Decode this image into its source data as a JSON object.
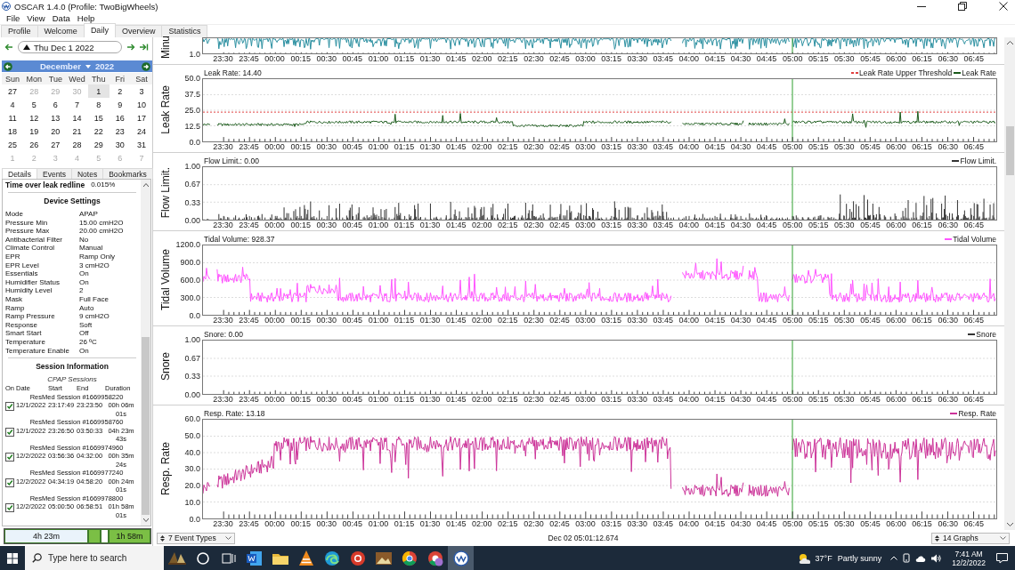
{
  "window": {
    "title": "OSCAR 1.4.0 (Profile: TwoBigWheels)"
  },
  "menu": [
    "File",
    "View",
    "Data",
    "Help"
  ],
  "tabs": [
    {
      "label": "Profile",
      "selected": false
    },
    {
      "label": "Welcome",
      "selected": false
    },
    {
      "label": "Daily",
      "selected": true
    },
    {
      "label": "Overview",
      "selected": false
    },
    {
      "label": "Statistics",
      "selected": false
    }
  ],
  "date_nav": {
    "date": "Thu Dec 1 2022"
  },
  "calendar": {
    "month": "December",
    "year": "2022",
    "weekdays": [
      "Sun",
      "Mon",
      "Tue",
      "Wed",
      "Thu",
      "Fri",
      "Sat"
    ],
    "weeks": [
      [
        {
          "day": "27",
          "dimmed": false,
          "selected": false
        },
        {
          "day": "28",
          "dimmed": true,
          "selected": false
        },
        {
          "day": "29",
          "dimmed": true,
          "selected": false
        },
        {
          "day": "30",
          "dimmed": true,
          "selected": false
        },
        {
          "day": "1",
          "dimmed": false,
          "selected": true
        },
        {
          "day": "2",
          "dimmed": false,
          "selected": false
        },
        {
          "day": "3",
          "dimmed": false,
          "selected": false
        }
      ],
      [
        {
          "day": "4",
          "dimmed": false,
          "selected": false
        },
        {
          "day": "5",
          "dimmed": false,
          "selected": false
        },
        {
          "day": "6",
          "dimmed": false,
          "selected": false
        },
        {
          "day": "7",
          "dimmed": false,
          "selected": false
        },
        {
          "day": "8",
          "dimmed": false,
          "selected": false
        },
        {
          "day": "9",
          "dimmed": false,
          "selected": false
        },
        {
          "day": "10",
          "dimmed": false,
          "selected": false
        }
      ],
      [
        {
          "day": "11",
          "dimmed": false,
          "selected": false
        },
        {
          "day": "12",
          "dimmed": false,
          "selected": false
        },
        {
          "day": "13",
          "dimmed": false,
          "selected": false
        },
        {
          "day": "14",
          "dimmed": false,
          "selected": false
        },
        {
          "day": "15",
          "dimmed": false,
          "selected": false
        },
        {
          "day": "16",
          "dimmed": false,
          "selected": false
        },
        {
          "day": "17",
          "dimmed": false,
          "selected": false
        }
      ],
      [
        {
          "day": "18",
          "dimmed": false,
          "selected": false
        },
        {
          "day": "19",
          "dimmed": false,
          "selected": false
        },
        {
          "day": "20",
          "dimmed": false,
          "selected": false
        },
        {
          "day": "21",
          "dimmed": false,
          "selected": false
        },
        {
          "day": "22",
          "dimmed": false,
          "selected": false
        },
        {
          "day": "23",
          "dimmed": false,
          "selected": false
        },
        {
          "day": "24",
          "dimmed": false,
          "selected": false
        }
      ],
      [
        {
          "day": "25",
          "dimmed": false,
          "selected": false
        },
        {
          "day": "26",
          "dimmed": false,
          "selected": false
        },
        {
          "day": "27",
          "dimmed": false,
          "selected": false
        },
        {
          "day": "28",
          "dimmed": false,
          "selected": false
        },
        {
          "day": "29",
          "dimmed": false,
          "selected": false
        },
        {
          "day": "30",
          "dimmed": false,
          "selected": false
        },
        {
          "day": "31",
          "dimmed": false,
          "selected": false
        }
      ],
      [
        {
          "day": "1",
          "dimmed": true,
          "selected": false
        },
        {
          "day": "2",
          "dimmed": true,
          "selected": false
        },
        {
          "day": "3",
          "dimmed": true,
          "selected": false
        },
        {
          "day": "4",
          "dimmed": true,
          "selected": false
        },
        {
          "day": "5",
          "dimmed": true,
          "selected": false
        },
        {
          "day": "6",
          "dimmed": true,
          "selected": false
        },
        {
          "day": "7",
          "dimmed": true,
          "selected": false
        }
      ]
    ]
  },
  "detail_tabs": [
    {
      "label": "Details",
      "selected": true
    },
    {
      "label": "Events",
      "selected": false
    },
    {
      "label": "Notes",
      "selected": false
    },
    {
      "label": "Bookmarks",
      "selected": false
    }
  ],
  "details": {
    "summary": [
      {
        "label": "Time over leak redline",
        "value": "0.015%"
      }
    ],
    "device_settings": {
      "heading": "Device Settings",
      "rows": [
        {
          "label": "Mode",
          "value": "APAP"
        },
        {
          "label": "Pressure Min",
          "value": "15.00 cmH2O"
        },
        {
          "label": "Pressure Max",
          "value": "20.00 cmH2O"
        },
        {
          "label": "Antibacterial Filter",
          "value": "No"
        },
        {
          "label": "Climate Control",
          "value": "Manual"
        },
        {
          "label": "EPR",
          "value": "Ramp Only"
        },
        {
          "label": "EPR Level",
          "value": "3 cmH2O"
        },
        {
          "label": "Essentials",
          "value": "On"
        },
        {
          "label": "Humidifier Status",
          "value": "On"
        },
        {
          "label": "Humidity Level",
          "value": "2"
        },
        {
          "label": "Mask",
          "value": "Full Face"
        },
        {
          "label": "Ramp",
          "value": "Auto"
        },
        {
          "label": "Ramp Pressure",
          "value": "9 cmH2O"
        },
        {
          "label": "Response",
          "value": "Soft"
        },
        {
          "label": "Smart Start",
          "value": "Off"
        },
        {
          "label": "Temperature",
          "value": "26 ºC"
        },
        {
          "label": "Temperature Enable",
          "value": "On"
        }
      ]
    },
    "session_info": {
      "heading": "Session Information",
      "subheading": "CPAP Sessions",
      "columns": [
        "On",
        "Date",
        "Start",
        "End",
        "Duration"
      ],
      "sessions": [
        {
          "title": "ResMed Session #1669958220",
          "checked": true,
          "date": "12/1/2022",
          "start": "23:17:49",
          "end": "23:23:50",
          "duration": "00h 06m 01s"
        },
        {
          "title": "ResMed Session #1669958760",
          "checked": true,
          "date": "12/1/2022",
          "start": "23:26:50",
          "end": "03:50:33",
          "duration": "04h 23m 43s"
        },
        {
          "title": "ResMed Session #1669974960",
          "checked": true,
          "date": "12/2/2022",
          "start": "03:56:36",
          "end": "04:32:00",
          "duration": "00h 35m 24s"
        },
        {
          "title": "ResMed Session #1669977240",
          "checked": true,
          "date": "12/2/2022",
          "start": "04:34:19",
          "end": "04:58:20",
          "duration": "00h 24m 01s"
        },
        {
          "title": "ResMed Session #1669978800",
          "checked": true,
          "date": "12/2/2022",
          "start": "05:00:50",
          "end": "06:58:51",
          "duration": "01h 58m 01s"
        }
      ]
    }
  },
  "timeline": {
    "segments": [
      {
        "text": "4h 23m",
        "kind": "pale"
      },
      {
        "kind": "green"
      },
      {
        "kind": "white"
      },
      {
        "text": "1h 58m",
        "kind": "green"
      }
    ]
  },
  "graphs": [
    {
      "kind": "minute",
      "label": "Minu",
      "color": "#2a8fa0",
      "yticks": [
        "1.0"
      ],
      "xticks": [
        "23:30",
        "23:45",
        "00:00",
        "00:15",
        "00:30",
        "00:45",
        "01:00",
        "01:15",
        "01:30",
        "01:45",
        "02:00",
        "02:15",
        "02:30",
        "02:45",
        "03:00",
        "03:15",
        "03:30",
        "03:45",
        "04:00",
        "04:15",
        "04:30",
        "04:45",
        "05:00",
        "05:15",
        "05:30",
        "05:45",
        "06:00",
        "06:15",
        "06:30",
        "06:45"
      ]
    },
    {
      "kind": "leak",
      "label": "Leak Rate",
      "header": "Leak Rate: 14.40",
      "color": "#1a5a1a",
      "legend": [
        {
          "text": "Leak Rate Upper Threshold",
          "color": "#e04040",
          "dashed": true
        },
        {
          "text": "Leak Rate",
          "color": "#1a5a1a",
          "dashed": false
        }
      ],
      "yticks": [
        "50.0",
        "37.5",
        "25.0",
        "12.5",
        "0.0"
      ],
      "xticks": [
        "23:30",
        "23:45",
        "00:00",
        "00:15",
        "00:30",
        "00:45",
        "01:00",
        "01:15",
        "01:30",
        "01:45",
        "02:00",
        "02:15",
        "02:30",
        "02:45",
        "03:00",
        "03:15",
        "03:30",
        "03:45",
        "04:00",
        "04:15",
        "04:30",
        "04:45",
        "05:00",
        "05:15",
        "05:30",
        "05:45",
        "06:00",
        "06:15",
        "06:30",
        "06:45"
      ]
    },
    {
      "kind": "flow",
      "label": "Flow Limit.",
      "header": "Flow Limit.: 0.00",
      "color": "#333333",
      "legend": [
        {
          "text": "Flow Limit.",
          "color": "#333333",
          "dashed": false
        }
      ],
      "yticks": [
        "1.00",
        "0.67",
        "0.33",
        "0.00"
      ],
      "xticks": [
        "23:30",
        "23:45",
        "00:00",
        "00:15",
        "00:30",
        "00:45",
        "01:00",
        "01:15",
        "01:30",
        "01:45",
        "02:00",
        "02:15",
        "02:30",
        "02:45",
        "03:00",
        "03:15",
        "03:30",
        "03:45",
        "04:00",
        "04:15",
        "04:30",
        "04:45",
        "05:00",
        "05:15",
        "05:30",
        "05:45",
        "06:00",
        "06:15",
        "06:30",
        "06:45"
      ]
    },
    {
      "kind": "tidal",
      "label": "Tidal Volume",
      "header": "Tidal Volume: 928.37",
      "color": "#ff55ff",
      "legend": [
        {
          "text": "Tidal Volume",
          "color": "#ff55ff",
          "dashed": false
        }
      ],
      "yticks": [
        "1200.0",
        "900.0",
        "600.0",
        "300.0",
        "0.0"
      ],
      "xticks": [
        "23:30",
        "23:45",
        "00:00",
        "00:15",
        "00:30",
        "00:45",
        "01:00",
        "01:15",
        "01:30",
        "01:45",
        "02:00",
        "02:15",
        "02:30",
        "02:45",
        "03:00",
        "03:15",
        "03:30",
        "03:45",
        "04:00",
        "04:15",
        "04:30",
        "04:45",
        "05:00",
        "05:15",
        "05:30",
        "05:45",
        "06:00",
        "06:15",
        "06:30",
        "06:45"
      ]
    },
    {
      "kind": "snore",
      "label": "Snore",
      "header": "Snore: 0.00",
      "legend": [
        {
          "text": "Snore",
          "color": "#333333",
          "dashed": false
        }
      ],
      "yticks": [
        "1.00",
        "0.67",
        "0.33",
        "0.00"
      ],
      "xticks": [
        "23:30",
        "23:45",
        "00:00",
        "00:15",
        "00:30",
        "00:45",
        "01:00",
        "01:15",
        "01:30",
        "01:45",
        "02:00",
        "02:15",
        "02:30",
        "02:45",
        "03:00",
        "03:15",
        "03:30",
        "03:45",
        "04:00",
        "04:15",
        "04:30",
        "04:45",
        "05:00",
        "05:15",
        "05:30",
        "05:45",
        "06:00",
        "06:15",
        "06:30",
        "06:45"
      ]
    },
    {
      "kind": "resp",
      "label": "Resp. Rate",
      "header": "Resp. Rate: 13.18",
      "color": "#cc3399",
      "legend": [
        {
          "text": "Resp. Rate",
          "color": "#cc3399",
          "dashed": false
        }
      ],
      "yticks": [
        "60.0",
        "50.0",
        "40.0",
        "30.0",
        "20.0",
        "10.0",
        "0.0"
      ],
      "xticks": [
        "23:30",
        "23:45",
        "00:00",
        "00:15",
        "00:30",
        "00:45",
        "01:00",
        "01:15",
        "01:30",
        "01:45",
        "02:00",
        "02:15",
        "02:30",
        "02:45",
        "03:00",
        "03:15",
        "03:30",
        "03:45",
        "04:00",
        "04:15",
        "04:30",
        "04:45",
        "05:00",
        "05:15",
        "05:30",
        "05:45",
        "06:00",
        "06:15",
        "06:30",
        "06:45"
      ]
    }
  ],
  "graph_footer": {
    "event_types": "7 Event Types",
    "cursor_time": "Dec 02 05:01:12.674",
    "graph_count": "14 Graphs"
  },
  "taskbar": {
    "search_placeholder": "Type here to search",
    "apps": [
      {
        "kind": "books",
        "active": false
      },
      {
        "kind": "circle",
        "active": false
      },
      {
        "kind": "taskview",
        "active": false
      },
      {
        "kind": "document",
        "active": false
      },
      {
        "kind": "folder",
        "active": false
      },
      {
        "kind": "cone",
        "active": false
      },
      {
        "kind": "swirl",
        "active": false
      },
      {
        "kind": "ring",
        "active": false
      },
      {
        "kind": "photo",
        "active": false
      },
      {
        "kind": "wheel",
        "active": false
      },
      {
        "kind": "wheel2",
        "active": false
      },
      {
        "kind": "gauge",
        "active": true
      }
    ],
    "weather": {
      "temperature": "37°F",
      "condition": "Partly sunny"
    },
    "clock": {
      "time": "7:41 AM",
      "date": "12/2/2022"
    }
  }
}
